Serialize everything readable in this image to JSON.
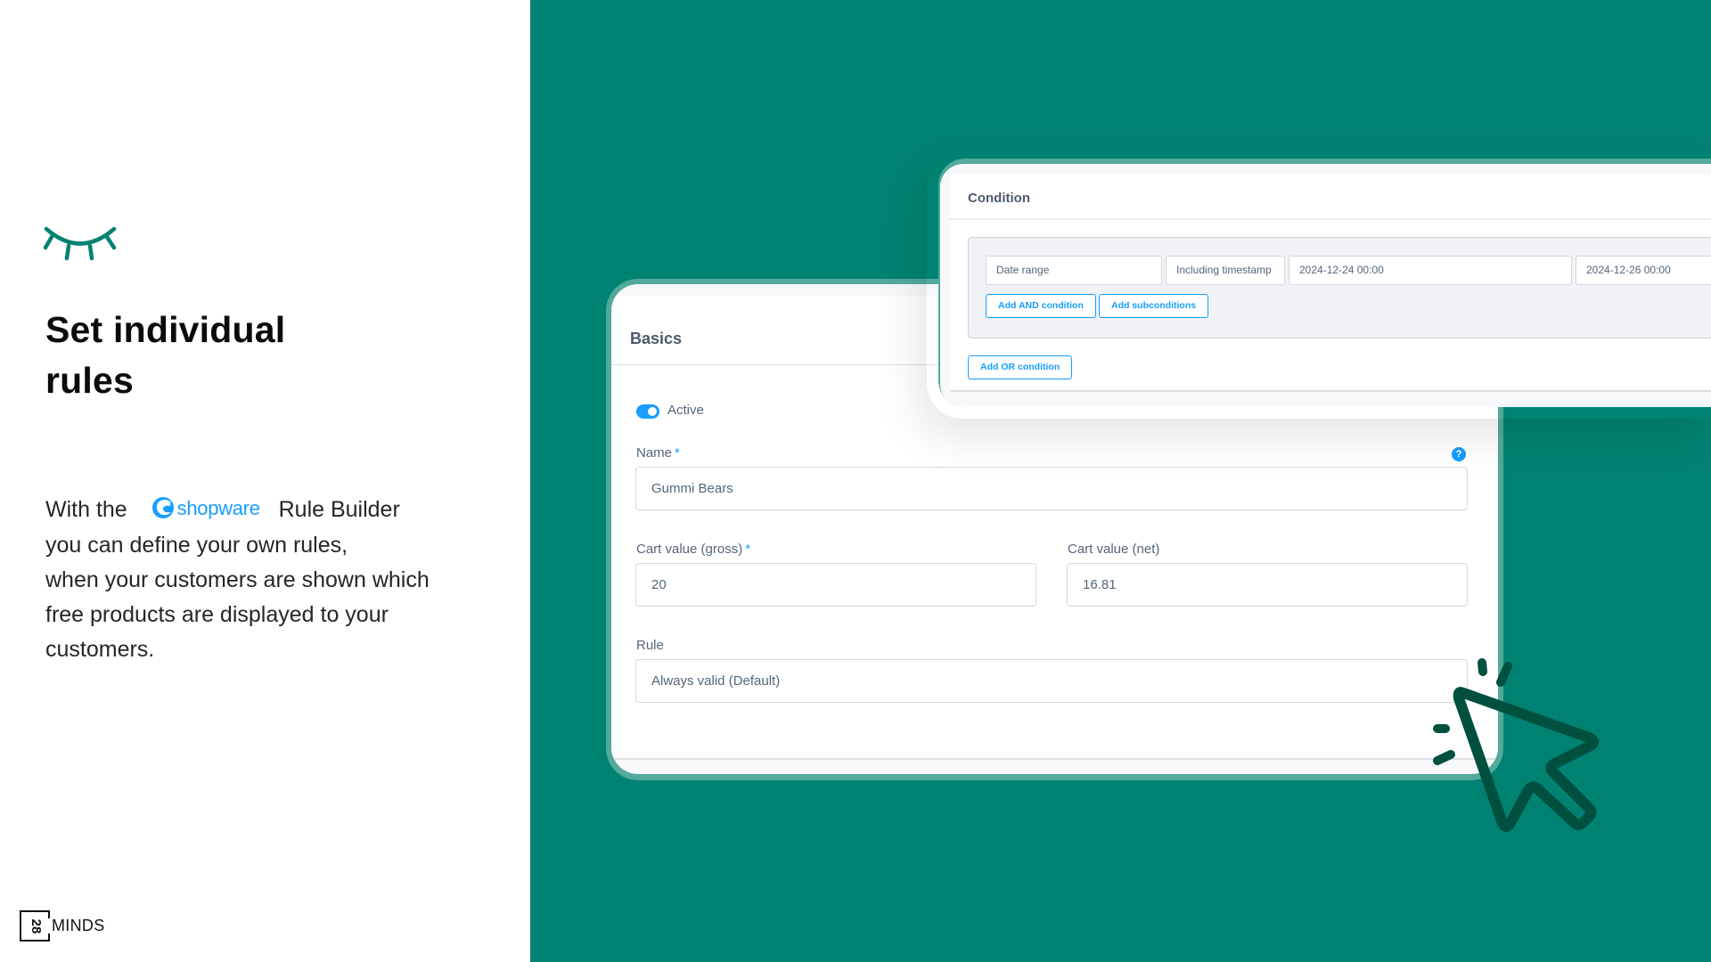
{
  "left_panel": {
    "icon": "closed-eye-icon",
    "headline_line1": "Set individual",
    "headline_line2": "rules",
    "body": {
      "line1_prefix": "With the",
      "brand_name": "shopware",
      "line1_suffix": "Rule Builder",
      "line2": "you can define your own rules,",
      "line3": "when your customers are shown which",
      "line4": "free products are displayed to your",
      "line5": "customers."
    },
    "footer_brand": {
      "number": "28",
      "word": "MINDS"
    }
  },
  "colors": {
    "panel_green": "#008272",
    "frame_green": "#52a99c",
    "accent_blue": "#189eff",
    "cursor_dark_green": "#00503f"
  },
  "condition_card": {
    "title": "Condition",
    "fields": [
      "Date range",
      "Including timestamp",
      "2024-12-24 00:00",
      "2024-12-26 00:00"
    ],
    "buttons": {
      "add_and": "Add AND condition",
      "add_sub": "Add subconditions",
      "add_or": "Add OR condition"
    }
  },
  "basics_card": {
    "title": "Basics",
    "active_label": "Active",
    "active": true,
    "name_label": "Name",
    "required_mark": "*",
    "name_value": "Gummi Bears",
    "help": "?",
    "cart_gross_label": "Cart value (gross)",
    "cart_gross_value": "20",
    "cart_net_label": "Cart value (net)",
    "cart_net_value": "16.81",
    "rule_label": "Rule",
    "rule_value": "Always valid (Default)"
  },
  "decor": {
    "cursor": "mouse-pointer-click-icon"
  }
}
